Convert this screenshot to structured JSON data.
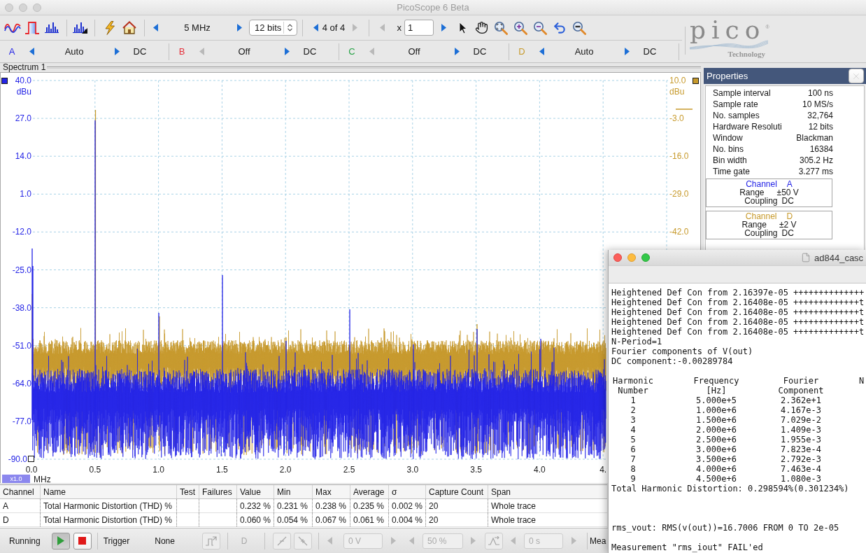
{
  "window": {
    "title": "PicoScope 6 Beta"
  },
  "toolbar": {
    "timebase": "5 MHz",
    "resolution": "12 bits",
    "buffer": {
      "text": "4 of 4",
      "prev_disabled": false,
      "next_disabled": true
    },
    "zoom": {
      "label": "x",
      "value": "1",
      "prev_disabled": true,
      "next_disabled": false
    }
  },
  "channels": [
    {
      "label": "A",
      "color": "#2424e6",
      "range": "Auto",
      "coupling": "DC",
      "prev_disabled": false
    },
    {
      "label": "B",
      "color": "#e5313c",
      "range": "Off",
      "coupling": "DC",
      "prev_disabled": true
    },
    {
      "label": "C",
      "color": "#27a347",
      "range": "Off",
      "coupling": "DC",
      "prev_disabled": true
    },
    {
      "label": "D",
      "color": "#c79a2c",
      "range": "Auto",
      "coupling": "DC",
      "prev_disabled": false
    }
  ],
  "logo": {
    "wordmark": "pico",
    "mark": "®",
    "tagline": "Technology"
  },
  "view": {
    "title": "Spectrum 1",
    "left_axis": {
      "unit": "dBu",
      "labels": [
        "40.0",
        "27.0",
        "14.0",
        "1.0",
        "-12.0",
        "-25.0",
        "-38.0",
        "-51.0",
        "-64.0",
        "-77.0",
        "-90.0"
      ]
    },
    "right_axis": {
      "unit": "dBu",
      "labels": [
        "10.0",
        "-3.0",
        "-16.0",
        "-29.0",
        "-42.0"
      ]
    },
    "x_axis": {
      "zoom": "x1.0",
      "unit": "MHz",
      "labels": [
        "0.0",
        "0.5",
        "1.0",
        "1.5",
        "2.0",
        "2.5",
        "3.0",
        "3.5",
        "4.0",
        "4."
      ]
    }
  },
  "properties": {
    "title": "Properties",
    "rows": [
      {
        "label": "Sample interval",
        "value": "100 ns"
      },
      {
        "label": "Sample rate",
        "value": "10 MS/s"
      },
      {
        "label": "No. samples",
        "value": "32,764"
      },
      {
        "label": "Hardware Resoluti",
        "value": "12 bits"
      },
      {
        "label": "Window",
        "value": "Blackman"
      },
      {
        "label": "No. bins",
        "value": "16384"
      },
      {
        "label": "Bin width",
        "value": "305.2 Hz"
      },
      {
        "label": "Time gate",
        "value": "3.277 ms"
      }
    ],
    "channel_boxes": [
      {
        "title": "Channel",
        "channel": "A",
        "color": "#2424e6",
        "range_label": "Range",
        "range": "±50 V",
        "coupling_label": "Coupling",
        "coupling": "DC"
      },
      {
        "title": "Channel",
        "channel": "D",
        "color": "#c79a2c",
        "range_label": "Range",
        "range": "±2 V",
        "coupling_label": "Coupling",
        "coupling": "DC"
      }
    ]
  },
  "measurements": {
    "columns": [
      "Channel",
      "Name",
      "Test",
      "Failures",
      "Value",
      "Min",
      "Max",
      "Average",
      "σ",
      "Capture Count",
      "Span"
    ],
    "rows": [
      {
        "channel": "A",
        "name": "Total Harmonic Distortion (THD) %",
        "value": "0.232 %",
        "min": "0.231 %",
        "max": "0.238 %",
        "average": "0.235 %",
        "sigma": "0.002 %",
        "capture_count": "20",
        "span": "Whole trace"
      },
      {
        "channel": "D",
        "name": "Total Harmonic Distortion (THD) %",
        "value": "0.060 %",
        "min": "0.054 %",
        "max": "0.067 %",
        "average": "0.061 %",
        "sigma": "0.004 %",
        "capture_count": "20",
        "span": "Whole trace"
      }
    ]
  },
  "status_bar": {
    "state": "Running",
    "run_buttons": [
      {
        "kind": "play",
        "selected": true
      },
      {
        "kind": "stop",
        "selected": false
      }
    ],
    "trigger_label": "Trigger",
    "trigger_mode": "None",
    "trigger_controls": {
      "disabled": true
    },
    "source": "D",
    "threshold": "0 V",
    "pre_trigger": "50 %",
    "delay": "0 s",
    "measurements_label": "Mea"
  },
  "terminal": {
    "title": "ad844_casc",
    "log_lines": [
      "Heightened Def Con from 2.16397e-05 ++++++++++++++",
      "Heightened Def Con from 2.16408e-05 +++++++++++++t",
      "Heightened Def Con from 2.16408e-05 +++++++++++++t",
      "Heightened Def Con from 2.16408e-05 +++++++++++++t",
      "Heightened Def Con from 2.16408e-05 +++++++++++++t",
      "N-Period=1",
      "Fourier components of V(out)",
      "DC component:-0.00289784"
    ],
    "harmonics": {
      "header_rows": [
        [
          "Harmonic",
          "Frequency",
          "Fourier",
          "N"
        ],
        [
          "Number",
          "[Hz]",
          "Component"
        ]
      ],
      "rows": [
        [
          "1",
          "5.000e+5",
          "2.362e+1"
        ],
        [
          "2",
          "1.000e+6",
          "4.167e-3"
        ],
        [
          "3",
          "1.500e+6",
          "7.029e-2"
        ],
        [
          "4",
          "2.000e+6",
          "1.409e-3"
        ],
        [
          "5",
          "2.500e+6",
          "1.955e-3"
        ],
        [
          "6",
          "3.000e+6",
          "7.823e-4"
        ],
        [
          "7",
          "3.500e+6",
          "2.792e-3"
        ],
        [
          "8",
          "4.000e+6",
          "7.463e-4"
        ],
        [
          "9",
          "4.500e+6",
          "1.080e-3"
        ]
      ]
    },
    "summary": "Total Harmonic Distortion: 0.298594%(0.301234%)",
    "results": [
      "rms_vout: RMS(v(out))=16.7006 FROM 0 TO 2e-05",
      "Measurement \"rms_iout\" FAIL'ed"
    ]
  }
}
